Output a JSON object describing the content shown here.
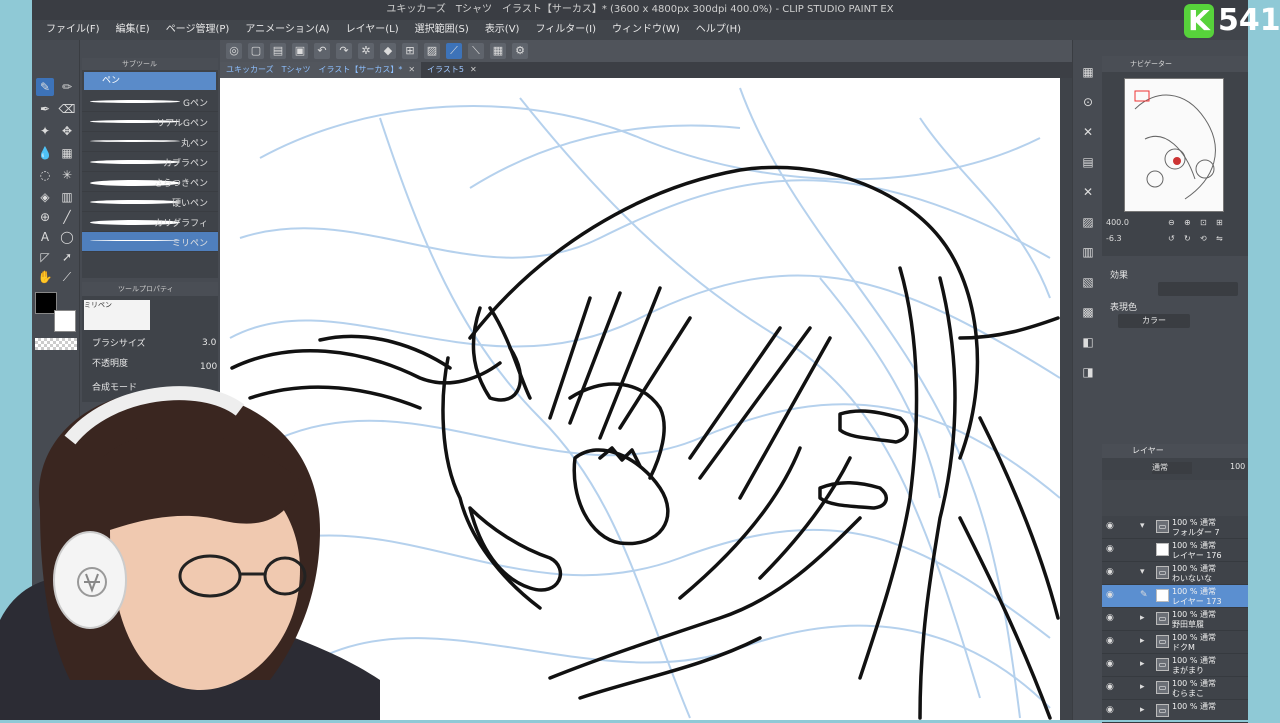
{
  "window": {
    "title": "ユキッカーズ　Tシャツ　イラスト【サーカス】* (3600 x 4800px 300dpi 400.0%)  - CLIP STUDIO PAINT EX"
  },
  "menu": [
    "ファイル(F)",
    "編集(E)",
    "ページ管理(P)",
    "アニメーション(A)",
    "レイヤー(L)",
    "選択範囲(S)",
    "表示(V)",
    "フィルター(I)",
    "ウィンドウ(W)",
    "ヘルプ(H)"
  ],
  "tabs": [
    {
      "label": "ユキッカーズ　Tシャツ　イラスト【サーカス】*"
    },
    {
      "label": "イラスト5"
    }
  ],
  "subtool": {
    "header": "サブツール",
    "group": "ペン",
    "brushes": [
      "Gペン",
      "リアルGペン",
      "丸ペン",
      "カブラペン",
      "さらつきペン",
      "硬いペン",
      "カリグラフィ",
      "ミリペン"
    ]
  },
  "toolprop": {
    "header": "ツールプロパティ",
    "preview_label": "ミリペン",
    "brush_size_label": "ブラシサイズ",
    "brush_size": "3.0",
    "opacity_label": "不透明度",
    "opacity": "100",
    "blend_label": "合成モード"
  },
  "navigator": {
    "header": "ナビゲーター",
    "zoom": "400.0",
    "rotation": "-6.3"
  },
  "effect": {
    "header": "効果",
    "display_color_label": "表現色",
    "display_color_value": "カラー"
  },
  "layers": {
    "header": "レイヤー",
    "blend": "通常",
    "opacity": "100",
    "rows": [
      {
        "mode": "100 % 通常",
        "name": "フォルダー 7",
        "type": "folder",
        "expanded": true
      },
      {
        "mode": "100 % 通常",
        "name": "レイヤー 176",
        "type": "layer"
      },
      {
        "mode": "100 % 通常",
        "name": "わいないな",
        "type": "folder",
        "expanded": true
      },
      {
        "mode": "100 % 通常",
        "name": "レイヤー 173",
        "type": "layer",
        "selected": true
      },
      {
        "mode": "100 % 通常",
        "name": "野田草履",
        "type": "folder"
      },
      {
        "mode": "100 % 通常",
        "name": "ドクM",
        "type": "folder"
      },
      {
        "mode": "100 % 通常",
        "name": "まがまり",
        "type": "folder"
      },
      {
        "mode": "100 % 通常",
        "name": "むらまこ",
        "type": "folder"
      },
      {
        "mode": "100 % 通常",
        "name": "",
        "type": "folder"
      }
    ]
  },
  "badge": {
    "letter": "K",
    "number": "541"
  },
  "colors": {
    "accent": "#3d73b9",
    "badge_green": "#57d23b",
    "sketch_blue": "#a9c9ea"
  }
}
